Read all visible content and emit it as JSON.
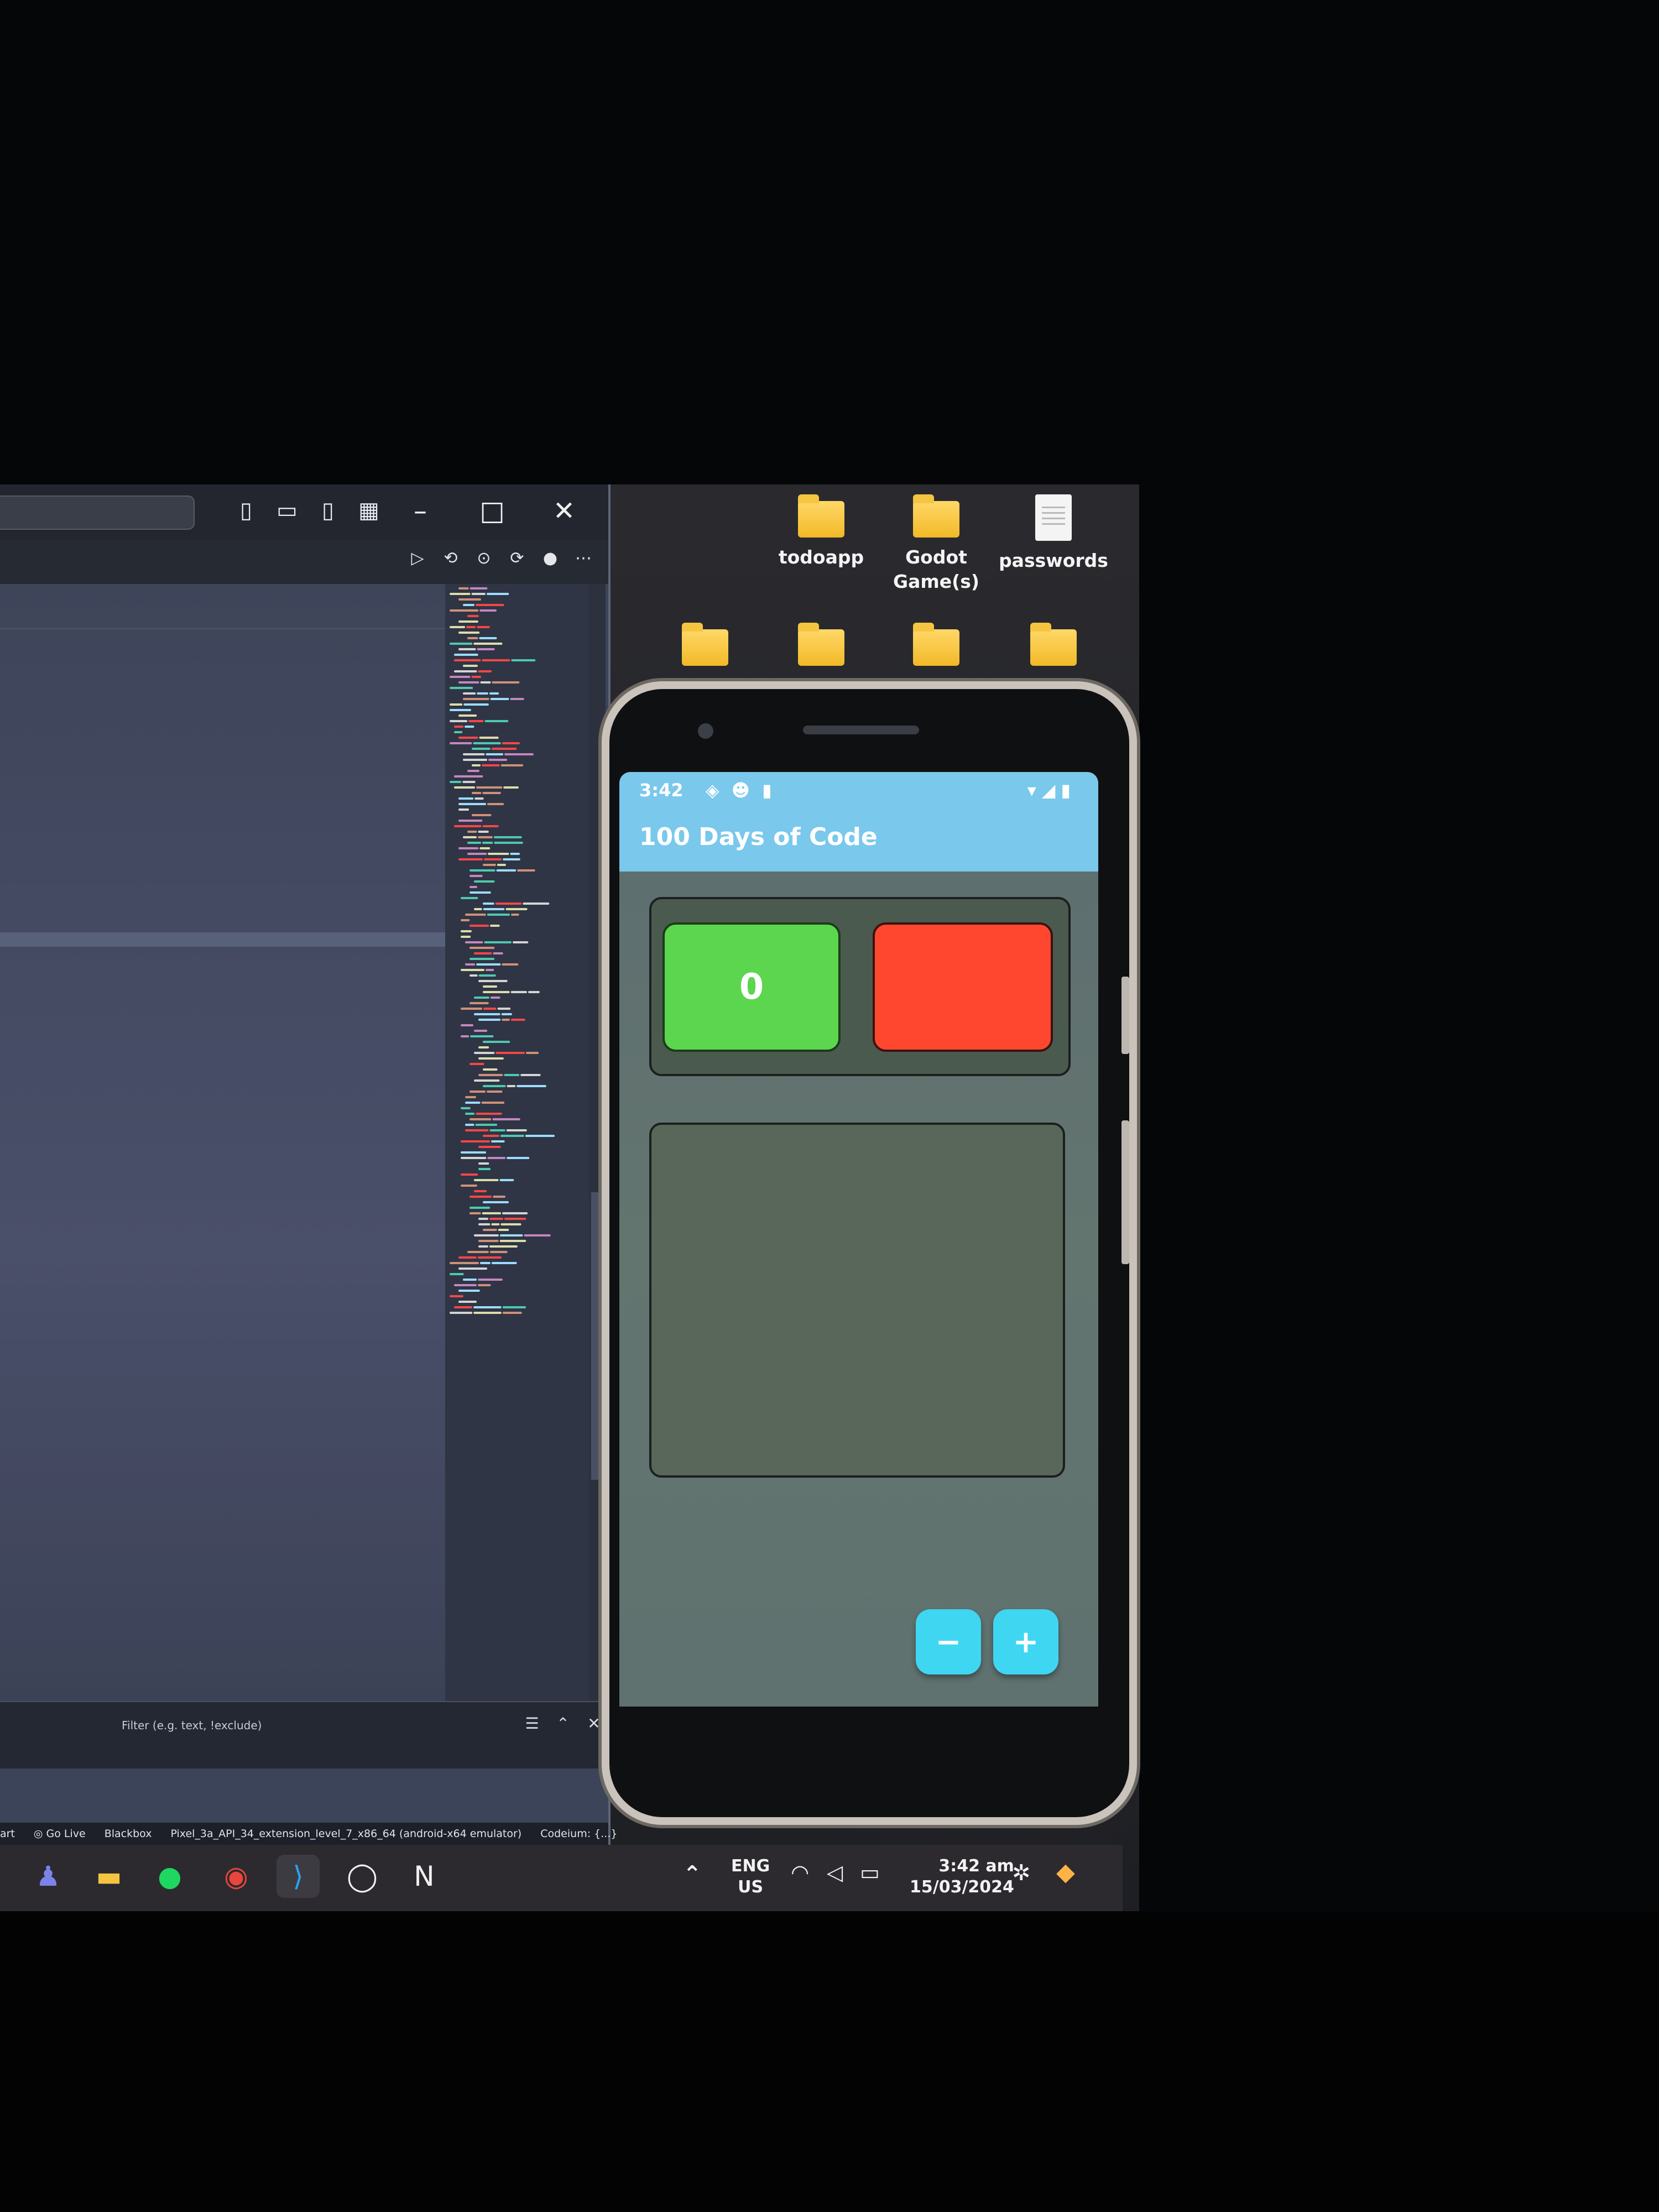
{
  "desktop": {
    "icons_top": [
      {
        "label": "todoapp",
        "type": "folder"
      },
      {
        "label": "Godot Game(s)",
        "type": "folder"
      },
      {
        "label": "passwords",
        "type": "document"
      }
    ]
  },
  "vscode": {
    "panel_filter_placeholder": "Filter (e.g. text, !exclude)",
    "statusbar": {
      "item_start": "art",
      "go_live": "Go Live",
      "blackbox": "Blackbox",
      "emulator": "Pixel_3a_API_34_extension_level_7_x86_64 (android-x64 emulator)",
      "codeium": "Codeium: {...}"
    }
  },
  "phone_app": {
    "status_time": "3:42",
    "title": "100 Days of Code",
    "counter_value": "0",
    "minus_label": "−",
    "plus_label": "+",
    "colors": {
      "appbar": "#7ac8ec",
      "green_box": "#5cd64e",
      "red_box": "#ff4730",
      "fab": "#3fd6f2"
    }
  },
  "taskbar": {
    "apps": [
      "teams-icon",
      "file-explorer-icon",
      "spotify-icon",
      "chrome-icon",
      "vscode-icon",
      "app-icon",
      "notion-icon"
    ],
    "language_top": "ENG",
    "language_bottom": "US",
    "time": "3:42 am",
    "date": "15/03/2024"
  }
}
